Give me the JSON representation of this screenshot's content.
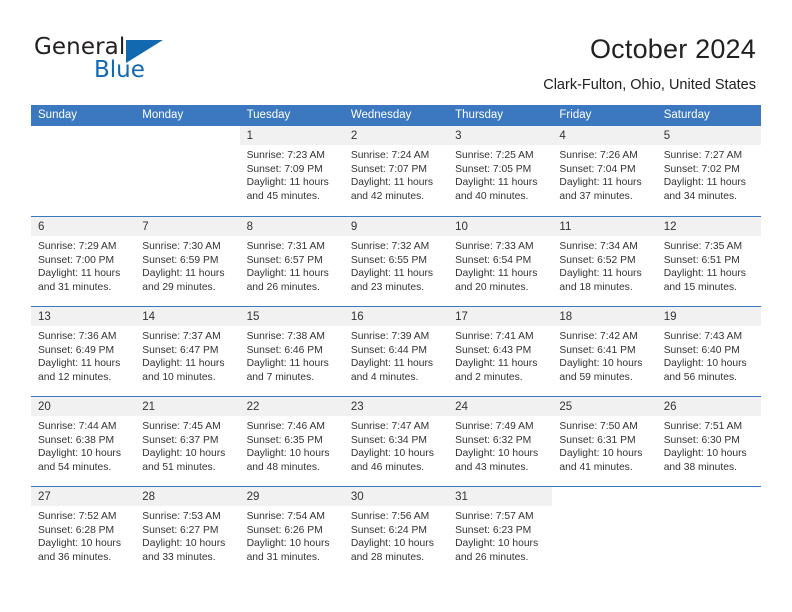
{
  "brand": {
    "name_part1": "General",
    "name_part2": "Blue",
    "accent_color": "#1269b0"
  },
  "header": {
    "title": "October 2024",
    "subtitle": "Clark-Fulton, Ohio, United States"
  },
  "theme": {
    "header_blue": "#3b78bf",
    "daynum_strip_gray": "#f1f1f1",
    "text": "#333333"
  },
  "calendar": {
    "weekdays": [
      "Sunday",
      "Monday",
      "Tuesday",
      "Wednesday",
      "Thursday",
      "Friday",
      "Saturday"
    ],
    "weeks": [
      [
        {
          "day": "",
          "sunrise": "",
          "sunset": "",
          "daylight1": "",
          "daylight2": "",
          "empty": true
        },
        {
          "day": "",
          "sunrise": "",
          "sunset": "",
          "daylight1": "",
          "daylight2": "",
          "empty": true
        },
        {
          "day": "1",
          "sunrise": "Sunrise: 7:23 AM",
          "sunset": "Sunset: 7:09 PM",
          "daylight1": "Daylight: 11 hours",
          "daylight2": "and 45 minutes."
        },
        {
          "day": "2",
          "sunrise": "Sunrise: 7:24 AM",
          "sunset": "Sunset: 7:07 PM",
          "daylight1": "Daylight: 11 hours",
          "daylight2": "and 42 minutes."
        },
        {
          "day": "3",
          "sunrise": "Sunrise: 7:25 AM",
          "sunset": "Sunset: 7:05 PM",
          "daylight1": "Daylight: 11 hours",
          "daylight2": "and 40 minutes."
        },
        {
          "day": "4",
          "sunrise": "Sunrise: 7:26 AM",
          "sunset": "Sunset: 7:04 PM",
          "daylight1": "Daylight: 11 hours",
          "daylight2": "and 37 minutes."
        },
        {
          "day": "5",
          "sunrise": "Sunrise: 7:27 AM",
          "sunset": "Sunset: 7:02 PM",
          "daylight1": "Daylight: 11 hours",
          "daylight2": "and 34 minutes."
        }
      ],
      [
        {
          "day": "6",
          "sunrise": "Sunrise: 7:29 AM",
          "sunset": "Sunset: 7:00 PM",
          "daylight1": "Daylight: 11 hours",
          "daylight2": "and 31 minutes."
        },
        {
          "day": "7",
          "sunrise": "Sunrise: 7:30 AM",
          "sunset": "Sunset: 6:59 PM",
          "daylight1": "Daylight: 11 hours",
          "daylight2": "and 29 minutes."
        },
        {
          "day": "8",
          "sunrise": "Sunrise: 7:31 AM",
          "sunset": "Sunset: 6:57 PM",
          "daylight1": "Daylight: 11 hours",
          "daylight2": "and 26 minutes."
        },
        {
          "day": "9",
          "sunrise": "Sunrise: 7:32 AM",
          "sunset": "Sunset: 6:55 PM",
          "daylight1": "Daylight: 11 hours",
          "daylight2": "and 23 minutes."
        },
        {
          "day": "10",
          "sunrise": "Sunrise: 7:33 AM",
          "sunset": "Sunset: 6:54 PM",
          "daylight1": "Daylight: 11 hours",
          "daylight2": "and 20 minutes."
        },
        {
          "day": "11",
          "sunrise": "Sunrise: 7:34 AM",
          "sunset": "Sunset: 6:52 PM",
          "daylight1": "Daylight: 11 hours",
          "daylight2": "and 18 minutes."
        },
        {
          "day": "12",
          "sunrise": "Sunrise: 7:35 AM",
          "sunset": "Sunset: 6:51 PM",
          "daylight1": "Daylight: 11 hours",
          "daylight2": "and 15 minutes."
        }
      ],
      [
        {
          "day": "13",
          "sunrise": "Sunrise: 7:36 AM",
          "sunset": "Sunset: 6:49 PM",
          "daylight1": "Daylight: 11 hours",
          "daylight2": "and 12 minutes."
        },
        {
          "day": "14",
          "sunrise": "Sunrise: 7:37 AM",
          "sunset": "Sunset: 6:47 PM",
          "daylight1": "Daylight: 11 hours",
          "daylight2": "and 10 minutes."
        },
        {
          "day": "15",
          "sunrise": "Sunrise: 7:38 AM",
          "sunset": "Sunset: 6:46 PM",
          "daylight1": "Daylight: 11 hours",
          "daylight2": "and 7 minutes."
        },
        {
          "day": "16",
          "sunrise": "Sunrise: 7:39 AM",
          "sunset": "Sunset: 6:44 PM",
          "daylight1": "Daylight: 11 hours",
          "daylight2": "and 4 minutes."
        },
        {
          "day": "17",
          "sunrise": "Sunrise: 7:41 AM",
          "sunset": "Sunset: 6:43 PM",
          "daylight1": "Daylight: 11 hours",
          "daylight2": "and 2 minutes."
        },
        {
          "day": "18",
          "sunrise": "Sunrise: 7:42 AM",
          "sunset": "Sunset: 6:41 PM",
          "daylight1": "Daylight: 10 hours",
          "daylight2": "and 59 minutes."
        },
        {
          "day": "19",
          "sunrise": "Sunrise: 7:43 AM",
          "sunset": "Sunset: 6:40 PM",
          "daylight1": "Daylight: 10 hours",
          "daylight2": "and 56 minutes."
        }
      ],
      [
        {
          "day": "20",
          "sunrise": "Sunrise: 7:44 AM",
          "sunset": "Sunset: 6:38 PM",
          "daylight1": "Daylight: 10 hours",
          "daylight2": "and 54 minutes."
        },
        {
          "day": "21",
          "sunrise": "Sunrise: 7:45 AM",
          "sunset": "Sunset: 6:37 PM",
          "daylight1": "Daylight: 10 hours",
          "daylight2": "and 51 minutes."
        },
        {
          "day": "22",
          "sunrise": "Sunrise: 7:46 AM",
          "sunset": "Sunset: 6:35 PM",
          "daylight1": "Daylight: 10 hours",
          "daylight2": "and 48 minutes."
        },
        {
          "day": "23",
          "sunrise": "Sunrise: 7:47 AM",
          "sunset": "Sunset: 6:34 PM",
          "daylight1": "Daylight: 10 hours",
          "daylight2": "and 46 minutes."
        },
        {
          "day": "24",
          "sunrise": "Sunrise: 7:49 AM",
          "sunset": "Sunset: 6:32 PM",
          "daylight1": "Daylight: 10 hours",
          "daylight2": "and 43 minutes."
        },
        {
          "day": "25",
          "sunrise": "Sunrise: 7:50 AM",
          "sunset": "Sunset: 6:31 PM",
          "daylight1": "Daylight: 10 hours",
          "daylight2": "and 41 minutes."
        },
        {
          "day": "26",
          "sunrise": "Sunrise: 7:51 AM",
          "sunset": "Sunset: 6:30 PM",
          "daylight1": "Daylight: 10 hours",
          "daylight2": "and 38 minutes."
        }
      ],
      [
        {
          "day": "27",
          "sunrise": "Sunrise: 7:52 AM",
          "sunset": "Sunset: 6:28 PM",
          "daylight1": "Daylight: 10 hours",
          "daylight2": "and 36 minutes."
        },
        {
          "day": "28",
          "sunrise": "Sunrise: 7:53 AM",
          "sunset": "Sunset: 6:27 PM",
          "daylight1": "Daylight: 10 hours",
          "daylight2": "and 33 minutes."
        },
        {
          "day": "29",
          "sunrise": "Sunrise: 7:54 AM",
          "sunset": "Sunset: 6:26 PM",
          "daylight1": "Daylight: 10 hours",
          "daylight2": "and 31 minutes."
        },
        {
          "day": "30",
          "sunrise": "Sunrise: 7:56 AM",
          "sunset": "Sunset: 6:24 PM",
          "daylight1": "Daylight: 10 hours",
          "daylight2": "and 28 minutes."
        },
        {
          "day": "31",
          "sunrise": "Sunrise: 7:57 AM",
          "sunset": "Sunset: 6:23 PM",
          "daylight1": "Daylight: 10 hours",
          "daylight2": "and 26 minutes."
        },
        {
          "day": "",
          "sunrise": "",
          "sunset": "",
          "daylight1": "",
          "daylight2": "",
          "empty": true
        },
        {
          "day": "",
          "sunrise": "",
          "sunset": "",
          "daylight1": "",
          "daylight2": "",
          "empty": true
        }
      ]
    ]
  }
}
